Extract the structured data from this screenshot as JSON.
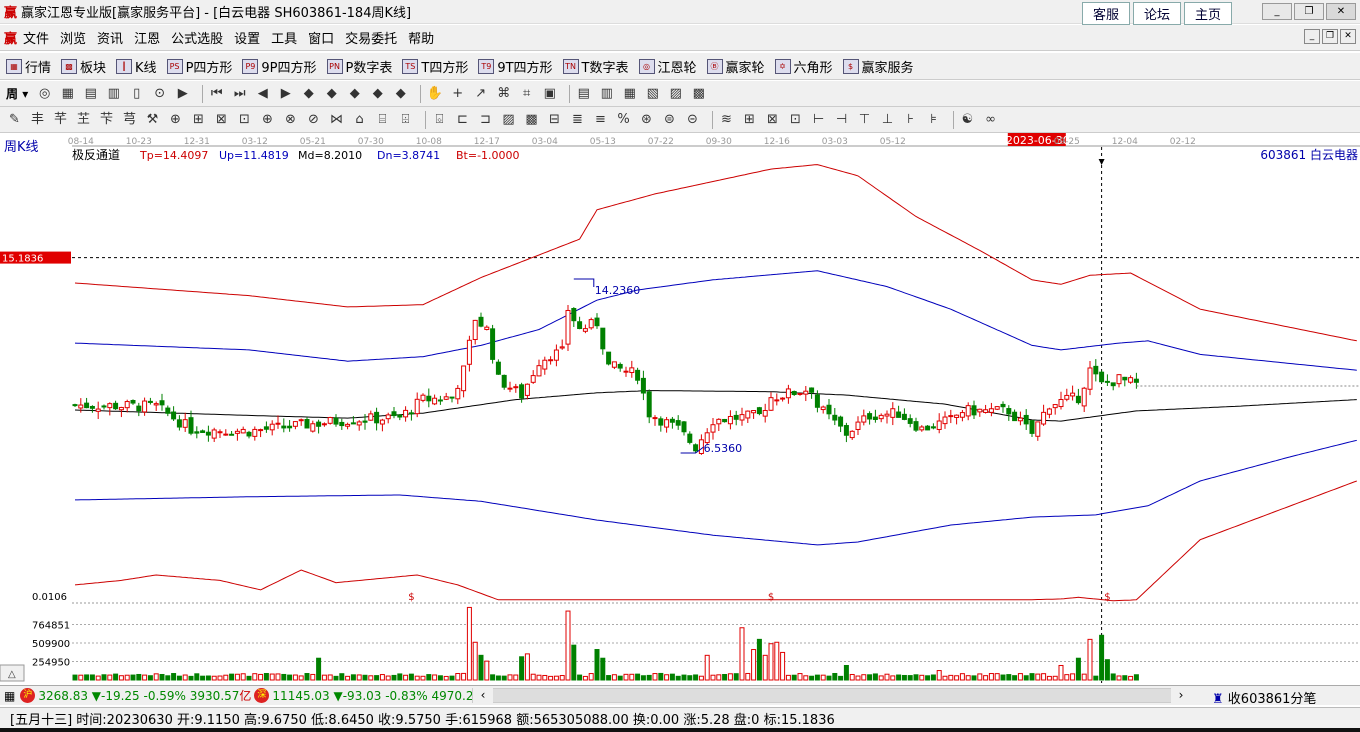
{
  "window": {
    "logo": "赢",
    "title": "赢家江恩专业版[赢家服务平台] - [白云电器  SH603861-184周K线]",
    "links": [
      "客服",
      "论坛",
      "主页"
    ],
    "controls": [
      "_",
      "❐",
      "✕"
    ]
  },
  "menu": {
    "logo": "赢",
    "items": [
      "文件",
      "浏览",
      "资讯",
      "江恩",
      "公式选股",
      "设置",
      "工具",
      "窗口",
      "交易委托",
      "帮助"
    ]
  },
  "toolbar1": [
    {
      "icon": "grid-icon",
      "glyph": "▦",
      "label": "行情"
    },
    {
      "icon": "blocks-icon",
      "glyph": "▩",
      "label": "板块"
    },
    {
      "icon": "candle-icon",
      "glyph": "┃",
      "label": "K线"
    },
    {
      "icon": "ps-icon",
      "glyph": "PS",
      "label": "P四方形"
    },
    {
      "icon": "p9-icon",
      "glyph": "P9",
      "label": "9P四方形"
    },
    {
      "icon": "pn-icon",
      "glyph": "PN",
      "label": "P数字表"
    },
    {
      "icon": "ts-icon",
      "glyph": "TS",
      "label": "T四方形"
    },
    {
      "icon": "t9-icon",
      "glyph": "T9",
      "label": "9T四方形"
    },
    {
      "icon": "tn-icon",
      "glyph": "TN",
      "label": "T数字表"
    },
    {
      "icon": "gann-wheel-icon",
      "glyph": "◎",
      "label": "江恩轮"
    },
    {
      "icon": "winner-wheel-icon",
      "glyph": "Ⓑ",
      "label": "赢家轮"
    },
    {
      "icon": "hexagon-icon",
      "glyph": "✡",
      "label": "六角形"
    },
    {
      "icon": "dollar-icon",
      "glyph": "$",
      "label": "赢家服务"
    }
  ],
  "toolbar2": {
    "period": "周",
    "icons": [
      "◎",
      "▦",
      "▤",
      "▥",
      "▯",
      "⊙",
      "▶",
      "⏮",
      "⏭",
      "◀",
      "▶",
      "◆",
      "◆",
      "◆",
      "◆",
      "◆",
      "✋",
      "+",
      "↗",
      "⌘",
      "⌗",
      "▣",
      "▤",
      "▥",
      "▦",
      "▧",
      "▨",
      "▩"
    ]
  },
  "toolbar3": {
    "icons": [
      "✎",
      "丰",
      "芊",
      "芏",
      "芐",
      "芎",
      "⚒",
      "⊕",
      "⊞",
      "⊠",
      "⊡",
      "⊕",
      "⊗",
      "⊘",
      "⋈",
      "⌂",
      "⌸",
      "⌹",
      "⌺",
      "⊏",
      "⊐",
      "▨",
      "▩",
      "⊟",
      "≣",
      "≡",
      "%",
      "⊛",
      "⊜",
      "⊝",
      "≋",
      "⊞",
      "⊠",
      "⊡",
      "⊢",
      "⊣",
      "⊤",
      "⊥",
      "⊦",
      "⊧",
      "☯",
      "∞"
    ]
  },
  "chart_data": {
    "type": "candlestick",
    "period_label": "周K线",
    "indicator": {
      "name": "极反通道",
      "Tp": "Tp=14.4097",
      "Up": "Up=11.4819",
      "Md": "Md=8.2010",
      "Dn": "Dn=3.8741",
      "Bt": "Bt=-1.0000"
    },
    "stock": "603861  白云电器",
    "x_ticks": [
      "08-14",
      "10-23",
      "12-31",
      "03-12",
      "05-21",
      "07-30",
      "10-08",
      "12-17",
      "03-04",
      "05-13",
      "07-22",
      "09-30",
      "12-16",
      "03-03",
      "05-12",
      "2023-06-30",
      "09-25",
      "12-04",
      "02-12"
    ],
    "x_tick_weeks": [
      1,
      11,
      21,
      31,
      41,
      51,
      61,
      71,
      81,
      91,
      101,
      111,
      121,
      131,
      141,
      166,
      171,
      181,
      191
    ],
    "cursor_week": 177,
    "cursor_price_label": "15.1836",
    "cursor_price": 15.1836,
    "high_label": "14.2360",
    "high": 14.236,
    "high_week": 86,
    "low_label": "6.5360",
    "low": 6.536,
    "low_week": 107,
    "num_weeks": 184,
    "axis_weeks": 221,
    "ylim": [
      -0.1,
      20.5
    ],
    "close_path": [
      [
        0,
        8.66
      ],
      [
        14,
        8.6
      ],
      [
        20,
        7.6
      ],
      [
        30,
        7.5
      ],
      [
        47,
        8.0
      ],
      [
        56,
        8.1
      ],
      [
        60,
        8.9
      ],
      [
        65,
        9.0
      ],
      [
        67,
        10.2
      ],
      [
        69,
        12.5
      ],
      [
        71,
        12.0
      ],
      [
        73,
        9.8
      ],
      [
        77,
        9.1
      ],
      [
        80,
        10.6
      ],
      [
        82,
        10.9
      ],
      [
        84,
        11.0
      ],
      [
        85,
        12.9
      ],
      [
        87,
        12.0
      ],
      [
        90,
        12.3
      ],
      [
        92,
        10.4
      ],
      [
        97,
        10.0
      ],
      [
        99,
        8.3
      ],
      [
        104,
        7.6
      ],
      [
        107,
        6.8
      ],
      [
        110,
        8.0
      ],
      [
        118,
        8.2
      ],
      [
        120,
        9.0
      ],
      [
        127,
        9.4
      ],
      [
        128,
        8.6
      ],
      [
        133,
        7.4
      ],
      [
        137,
        8.2
      ],
      [
        142,
        8.3
      ],
      [
        146,
        7.6
      ],
      [
        151,
        8.0
      ],
      [
        153,
        8.4
      ],
      [
        161,
        8.4
      ],
      [
        165,
        7.4
      ],
      [
        168,
        8.7
      ],
      [
        173,
        9.0
      ],
      [
        175,
        10.2
      ],
      [
        177,
        9.57
      ],
      [
        180,
        9.8
      ],
      [
        184,
        9.5
      ]
    ],
    "bands": [
      {
        "name": "Tp",
        "color": "#cc0000",
        "path": [
          [
            0,
            14.06
          ],
          [
            30,
            13.5
          ],
          [
            47,
            13.0
          ],
          [
            60,
            13.1
          ],
          [
            70,
            14.3
          ],
          [
            80,
            15.3
          ],
          [
            87,
            16.0
          ],
          [
            90,
            17.3
          ],
          [
            100,
            18.0
          ],
          [
            120,
            19.1
          ],
          [
            128,
            19.3
          ],
          [
            135,
            18.8
          ],
          [
            145,
            17.0
          ],
          [
            156,
            15.5
          ],
          [
            165,
            14.2
          ],
          [
            170,
            14.0
          ],
          [
            175,
            14.4
          ],
          [
            182,
            14.5
          ],
          [
            194,
            12.9
          ],
          [
            221,
            11.5
          ]
        ]
      },
      {
        "name": "Up",
        "color": "#0000bb",
        "path": [
          [
            0,
            11.4
          ],
          [
            30,
            11.1
          ],
          [
            47,
            10.6
          ],
          [
            60,
            10.8
          ],
          [
            70,
            11.3
          ],
          [
            80,
            12.0
          ],
          [
            90,
            13.3
          ],
          [
            97,
            13.75
          ],
          [
            110,
            14.2
          ],
          [
            128,
            14.6
          ],
          [
            140,
            13.9
          ],
          [
            151,
            12.9
          ],
          [
            165,
            11.3
          ],
          [
            170,
            11.1
          ],
          [
            180,
            11.4
          ],
          [
            185,
            11.5
          ],
          [
            194,
            10.9
          ],
          [
            221,
            10.2
          ]
        ]
      },
      {
        "name": "Md",
        "color": "#000000",
        "path": [
          [
            0,
            8.44
          ],
          [
            30,
            8.2
          ],
          [
            47,
            8.08
          ],
          [
            60,
            8.3
          ],
          [
            76,
            8.9
          ],
          [
            90,
            9.2
          ],
          [
            99,
            9.3
          ],
          [
            120,
            9.25
          ],
          [
            133,
            9.1
          ],
          [
            150,
            8.7
          ],
          [
            165,
            8.0
          ],
          [
            170,
            7.95
          ],
          [
            183,
            8.4
          ],
          [
            200,
            8.6
          ],
          [
            221,
            8.9
          ]
        ]
      },
      {
        "name": "Dn",
        "color": "#0000bb",
        "path": [
          [
            0,
            4.46
          ],
          [
            30,
            4.6
          ],
          [
            56,
            4.68
          ],
          [
            70,
            4.4
          ],
          [
            90,
            3.57
          ],
          [
            110,
            2.9
          ],
          [
            128,
            2.47
          ],
          [
            135,
            2.6
          ],
          [
            151,
            3.35
          ],
          [
            165,
            3.7
          ],
          [
            176,
            3.8
          ],
          [
            185,
            4.2
          ],
          [
            194,
            5.3
          ],
          [
            210,
            6.4
          ],
          [
            221,
            7.1
          ]
        ]
      },
      {
        "name": "Bt",
        "color": "#cc0000",
        "path": [
          [
            0,
            0.7
          ],
          [
            8,
            0.9
          ],
          [
            14,
            1.14
          ],
          [
            25,
            0.9
          ],
          [
            32,
            0.48
          ],
          [
            39,
            1.36
          ],
          [
            45,
            0.8
          ],
          [
            59,
            1.14
          ],
          [
            66,
            0.7
          ],
          [
            73,
            0.04
          ],
          [
            164,
            0.04
          ],
          [
            170,
            0.08
          ],
          [
            173,
            0.15
          ],
          [
            179,
            0.0
          ],
          [
            183,
            0.04
          ],
          [
            194,
            2.7
          ],
          [
            221,
            5.3
          ]
        ]
      }
    ],
    "bt_markers": [
      {
        "week": 58,
        "label": "$"
      },
      {
        "week": 120,
        "label": "$"
      },
      {
        "week": 178,
        "label": "$"
      }
    ],
    "bt_axis_label": "0.0106",
    "volume": {
      "ticks": [
        "764851",
        "509900",
        "254950"
      ],
      "tick_values": [
        764851,
        509900,
        254950
      ],
      "max": 1000000,
      "base": 70000,
      "spikes": [
        [
          42,
          300000
        ],
        [
          68,
          1000000
        ],
        [
          69,
          520000
        ],
        [
          70,
          340000
        ],
        [
          71,
          260000
        ],
        [
          77,
          320000
        ],
        [
          78,
          360000
        ],
        [
          85,
          950000
        ],
        [
          86,
          480000
        ],
        [
          90,
          420000
        ],
        [
          91,
          300000
        ],
        [
          109,
          340000
        ],
        [
          115,
          720000
        ],
        [
          117,
          420000
        ],
        [
          118,
          560000
        ],
        [
          119,
          340000
        ],
        [
          120,
          500000
        ],
        [
          121,
          520000
        ],
        [
          122,
          380000
        ],
        [
          133,
          200000
        ],
        [
          149,
          130000
        ],
        [
          170,
          200000
        ],
        [
          173,
          300000
        ],
        [
          175,
          560000
        ],
        [
          177,
          615968
        ],
        [
          178,
          280000
        ]
      ]
    }
  },
  "ticker": {
    "sh_badge": "沪",
    "sh": "3268.83 ▼-19.25 -0.59% 3930.57",
    "sh_unit": "亿",
    "sz_badge": "深",
    "sz": "11145.03 ▼-93.03 -0.83% 4970.20",
    "right": "收603861分笔"
  },
  "status": {
    "lunar": "[五月十三]",
    "time": "时间:20230630",
    "open": "开:9.1150",
    "high": "高:9.6750",
    "low": "低:8.6450",
    "close": "收:9.5750",
    "hands": "手:615968",
    "amount": "额:565305088.00",
    "turnover": "换:0.00",
    "change": "涨:5.28",
    "pan": "盘:0",
    "mark": "标:15.1836"
  }
}
